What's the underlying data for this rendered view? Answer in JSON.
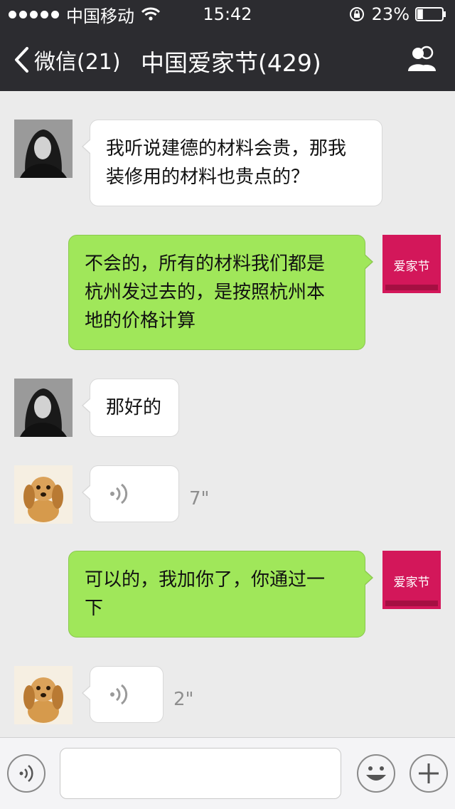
{
  "status_bar": {
    "carrier": "中国移动",
    "time": "15:42",
    "battery": "23%",
    "battery_level": 0.23
  },
  "nav": {
    "back_label": "微信(21)",
    "title": "中国爱家节(429)",
    "contacts_icon": "group-contacts-icon"
  },
  "messages": [
    {
      "side": "in",
      "sender": "girl",
      "type": "text",
      "lines": [
        "我听说建德的材料会贵，那我",
        "装修用的材料也贵点的？"
      ]
    },
    {
      "side": "out",
      "sender": "brand",
      "type": "text",
      "lines": [
        "不会的，所有的材料我们都是",
        "杭州发过去的，是按照杭州本",
        "地的价格计算"
      ]
    },
    {
      "side": "in",
      "sender": "girl",
      "type": "text",
      "lines": [
        "那好的"
      ]
    },
    {
      "side": "in",
      "sender": "puppy",
      "type": "voice",
      "duration": "7\""
    },
    {
      "side": "out",
      "sender": "brand",
      "type": "text",
      "lines": [
        "可以的，我加你了，你通过一",
        "下"
      ]
    },
    {
      "side": "in",
      "sender": "puppy",
      "type": "voice",
      "duration": "2\""
    }
  ],
  "avatars": {
    "brand_logo_text": "爱家节"
  },
  "input_bar": {
    "voice_icon": "voice-mode-icon",
    "emoji_icon": "emoji-icon",
    "plus_icon": "plus-icon",
    "text_value": ""
  },
  "colors": {
    "bar": "#2c2c30",
    "chat_bg": "#ebebeb",
    "out_bubble": "#a0e75a",
    "in_bubble": "#ffffff"
  }
}
